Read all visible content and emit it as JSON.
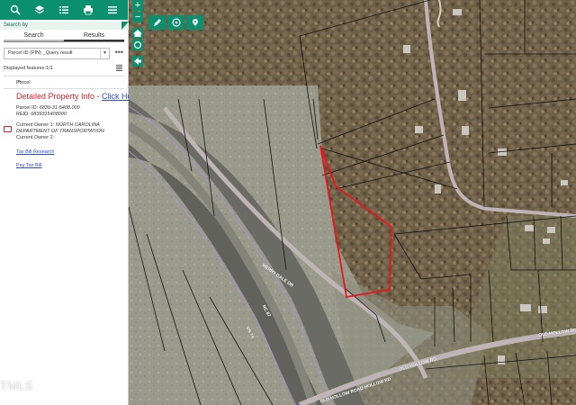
{
  "panel": {
    "toolbar": [
      {
        "icon": "search-location-icon"
      },
      {
        "icon": "layers-icon"
      },
      {
        "icon": "list-icon"
      },
      {
        "icon": "print-icon"
      },
      {
        "icon": "menu-icon"
      }
    ],
    "search_by_label": "Search by",
    "tabs": [
      {
        "label": "Search",
        "active": false
      },
      {
        "label": "Results",
        "active": true
      }
    ],
    "layer_select_value": "Parcel ID (PIN) _Query result",
    "more_label": "•••",
    "feature_count": "Displayed features:1/1",
    "parcel_header": "Parcel",
    "detail_link_text": "Detailed Property Info - ",
    "detail_link_action": "Click Here",
    "parcel_id_label": "Parcel ID:",
    "parcel_id_value": "6839-31-5408.000",
    "reid_label": "REID:",
    "reid_value": "6839315408000",
    "owner1_label": "Current Owner 1:",
    "owner1_value": "NORTH CAROLINA DEPARTMENT OF TRANSPORTATION",
    "owner2_label": "Current Owner 2:",
    "owner2_value": "",
    "tax_bill_research": "Tax Bill Research",
    "pay_tax_bill": "Pay Tax Bill",
    "watermark": "TMLS"
  },
  "map": {
    "zoom_in": "+",
    "zoom_out": "−",
    "tools": [
      {
        "icon": "pencil-icon"
      },
      {
        "icon": "measure-icon"
      },
      {
        "icon": "location-pin-icon"
      }
    ],
    "road_labels": [
      {
        "text": "MERRY DALE DR"
      },
      {
        "text": "NC 87"
      },
      {
        "text": "US 74"
      },
      {
        "text": "OLD HOLLOW RD"
      },
      {
        "text": "OLD HOLLOW RD"
      },
      {
        "text": "OLD HOLLOW ROAD HOLLOW RD"
      }
    ],
    "colors": {
      "highlight": "#e8161c",
      "parcel_line": "#111111",
      "road_line": "#c9a7e0",
      "accent": "#0a8f6f"
    }
  }
}
